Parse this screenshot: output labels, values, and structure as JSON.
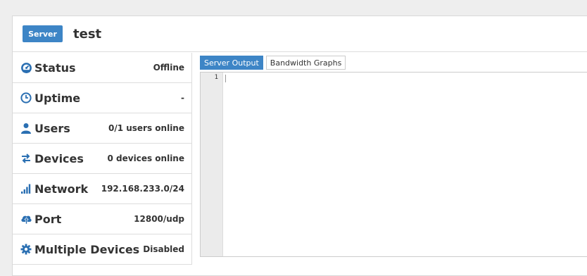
{
  "header": {
    "badge": "Server",
    "title": "test"
  },
  "stats": [
    {
      "label": "Status",
      "value": "Offline",
      "icon": "dashboard-icon"
    },
    {
      "label": "Uptime",
      "value": "-",
      "icon": "clock-icon"
    },
    {
      "label": "Users",
      "value": "0/1 users online",
      "icon": "user-icon"
    },
    {
      "label": "Devices",
      "value": "0 devices online",
      "icon": "exchange-icon"
    },
    {
      "label": "Network",
      "value": "192.168.233.0/24",
      "icon": "signal-bars-icon"
    },
    {
      "label": "Port",
      "value": "12800/udp",
      "icon": "cloud-upload-icon"
    },
    {
      "label": "Multiple Devices",
      "value": "Disabled",
      "icon": "gear-icon"
    }
  ],
  "tabs": {
    "server_output": "Server Output",
    "bandwidth_graphs": "Bandwidth Graphs"
  },
  "editor": {
    "line_numbers": [
      "1"
    ]
  },
  "colors": {
    "accent": "#3d85c6",
    "icon": "#2a6fb2"
  }
}
